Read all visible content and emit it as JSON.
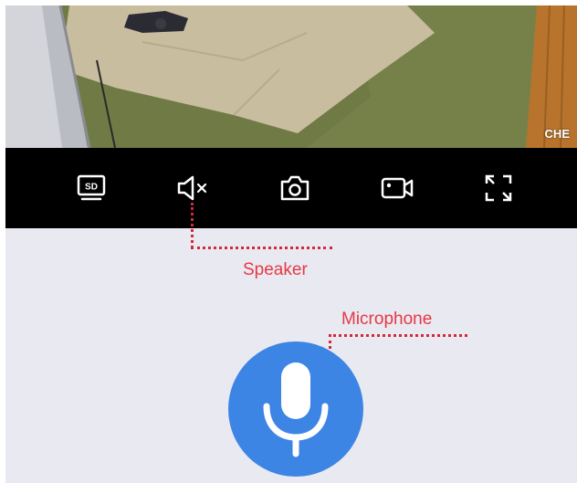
{
  "video": {
    "resolution_badge": "CHE"
  },
  "toolbar": {
    "items": [
      {
        "name": "sd-quality",
        "icon": "sd-icon"
      },
      {
        "name": "speaker",
        "icon": "speaker-muted-icon"
      },
      {
        "name": "snapshot",
        "icon": "camera-icon"
      },
      {
        "name": "record",
        "icon": "video-record-icon"
      },
      {
        "name": "fullscreen",
        "icon": "fullscreen-icon"
      }
    ]
  },
  "annotations": {
    "speaker_label": "Speaker",
    "microphone_label": "Microphone"
  },
  "mic_button": {
    "icon": "microphone-icon"
  },
  "colors": {
    "toolbar_bg": "#000000",
    "page_bg": "#e9e9f1",
    "accent": "#3d85e4",
    "annotation": "#e53945"
  }
}
